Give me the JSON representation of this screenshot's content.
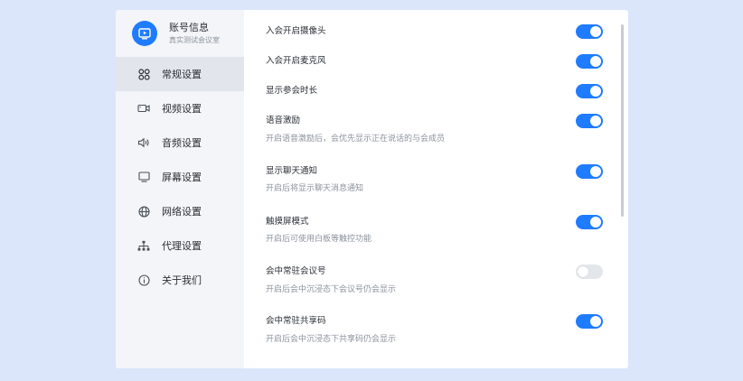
{
  "account": {
    "name": "账号信息",
    "subtitle": "真实测试会议室",
    "avatar_icon": "screen-play-icon",
    "avatar_color": "#1f7bff"
  },
  "sidebar": {
    "items": [
      {
        "label": "常规设置",
        "icon": "grid-circles-icon",
        "active": true
      },
      {
        "label": "视频设置",
        "icon": "video-camera-icon",
        "active": false
      },
      {
        "label": "音频设置",
        "icon": "speaker-icon",
        "active": false
      },
      {
        "label": "屏幕设置",
        "icon": "monitor-icon",
        "active": false
      },
      {
        "label": "网络设置",
        "icon": "globe-icon",
        "active": false
      },
      {
        "label": "代理设置",
        "icon": "network-tree-icon",
        "active": false
      },
      {
        "label": "关于我们",
        "icon": "info-icon",
        "active": false
      }
    ]
  },
  "settings": [
    {
      "title": "入会开启摄像头",
      "description": "",
      "enabled": true
    },
    {
      "title": "入会开启麦克风",
      "description": "",
      "enabled": true
    },
    {
      "title": "显示参会时长",
      "description": "",
      "enabled": true
    },
    {
      "title": "语音激励",
      "description": "开启语音激励后，会优先显示正在说话的与会成员",
      "enabled": true
    },
    {
      "title": "显示聊天通知",
      "description": "开启后将显示聊天消息通知",
      "enabled": true
    },
    {
      "title": "触摸屏模式",
      "description": "开启后可使用白板等触控功能",
      "enabled": true
    },
    {
      "title": "会中常驻会议号",
      "description": "开启后会中沉浸态下会议号仍会显示",
      "enabled": false
    },
    {
      "title": "会中常驻共享码",
      "description": "开启后会中沉浸态下共享码仍会显示",
      "enabled": true
    }
  ],
  "colors": {
    "accent": "#1f7bff",
    "toggle_off": "#e3e6ea"
  }
}
